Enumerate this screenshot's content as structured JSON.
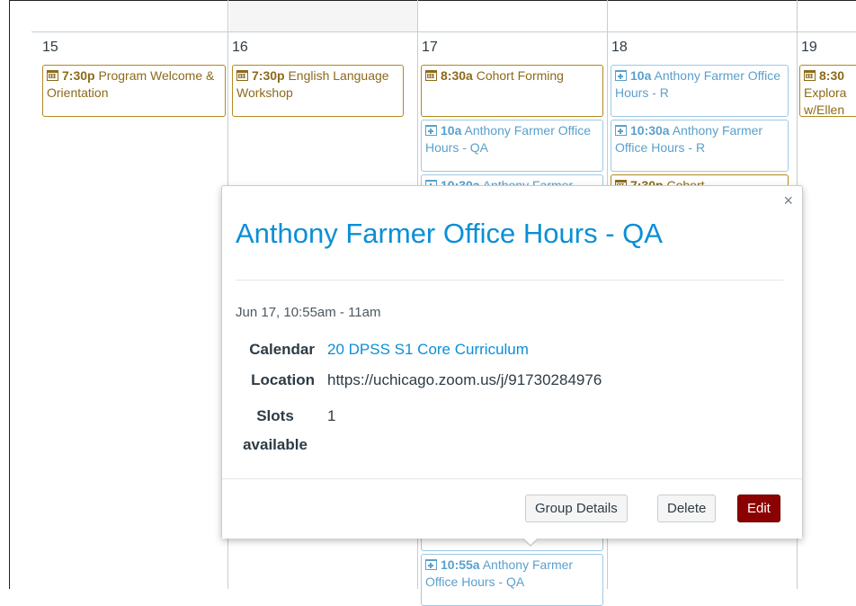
{
  "calendar": {
    "days": [
      {
        "num": "15"
      },
      {
        "num": "16"
      },
      {
        "num": "17"
      },
      {
        "num": "18"
      },
      {
        "num": "19"
      }
    ],
    "events": {
      "d15_1": {
        "time": "7:30p",
        "title": "Program Welcome & Orientation"
      },
      "d16_1": {
        "time": "7:30p",
        "title": "English Language Workshop"
      },
      "d17_1": {
        "time": "8:30a",
        "title": "Cohort Forming"
      },
      "d17_2": {
        "time": "10a",
        "title": "Anthony Farmer Office Hours - QA"
      },
      "d17_3": {
        "time": "10:30a",
        "title": "Anthony Farmer Office Hours - QA"
      },
      "d17_4": {
        "time": "10:55a",
        "title": "Anthony Farmer Office Hours - QA"
      },
      "d18_1": {
        "time": "10a",
        "title": "Anthony Farmer Office Hours - R"
      },
      "d18_2": {
        "time": "10:30a",
        "title": "Anthony Farmer Office Hours - R"
      },
      "d18_3": {
        "time": "7:30p",
        "title": "Cohort"
      },
      "d19_1": {
        "time": "8:30",
        "title": "Explora w/Ellen"
      }
    }
  },
  "popover": {
    "title": "Anthony Farmer Office Hours - QA",
    "when": "Jun 17, 10:55am - 11am",
    "calendar_label": "Calendar",
    "calendar_value": "20 DPSS S1 Core Curriculum",
    "location_label": "Location",
    "location_value": "https://uchicago.zoom.us/j/91730284976",
    "slots_label_1": "Slots",
    "slots_label_2": "available",
    "slots_value": "1",
    "close_symbol": "×",
    "buttons": {
      "group_details": "Group Details",
      "delete": "Delete",
      "edit": "Edit"
    }
  },
  "colors": {
    "event_gold": "#b3891f",
    "appointment_blue": "#5aa0cc",
    "link": "#0b8fd6",
    "edit_button": "#8b0000"
  }
}
